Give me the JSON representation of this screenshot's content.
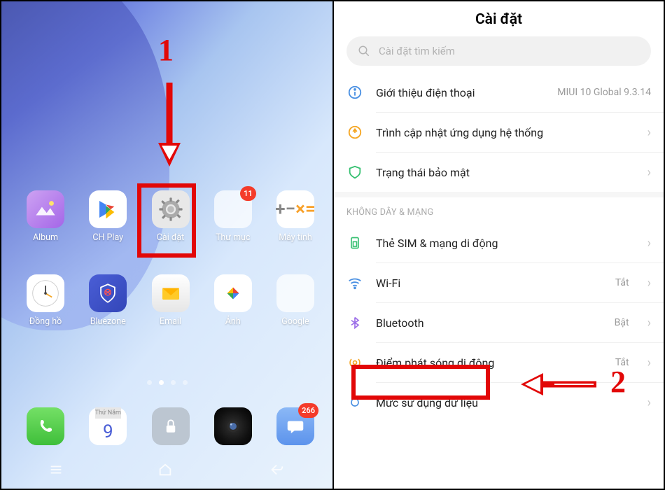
{
  "annotations": {
    "step1": "1",
    "step2": "2"
  },
  "homescreen": {
    "apps": {
      "album": "Album",
      "chplay": "CH Play",
      "settings": "Cài đặt",
      "folder": "Thư mục",
      "calc": "Máy tính",
      "clock": "Đồng hồ",
      "bluezone": "Bluezone",
      "email": "Email",
      "photos": "Ảnh",
      "google": "Google"
    },
    "dock": {
      "calendarDay": "Thứ Năm",
      "calendarNum": "9"
    },
    "badges": {
      "folder": "11",
      "msg": "266"
    }
  },
  "settings": {
    "title": "Cài đặt",
    "searchPlaceholder": "Cài đặt tìm kiếm",
    "sectionHdr": "KHÔNG DÂY & MẠNG",
    "items": {
      "about": {
        "label": "Giới thiệu điện thoại",
        "value": "MIUI 10 Global 9.3.14"
      },
      "update": {
        "label": "Trình cập nhật ứng dụng hệ thống"
      },
      "security": {
        "label": "Trạng thái bảo mật"
      },
      "sim": {
        "label": "Thẻ SIM & mạng di động"
      },
      "wifi": {
        "label": "Wi-Fi",
        "value": "Tắt"
      },
      "bt": {
        "label": "Bluetooth",
        "value": "Bật"
      },
      "hotspot": {
        "label": "Điểm phát sóng di động",
        "value": "Tắt"
      },
      "data": {
        "label": "Mức sử dụng dữ liệu"
      }
    }
  }
}
